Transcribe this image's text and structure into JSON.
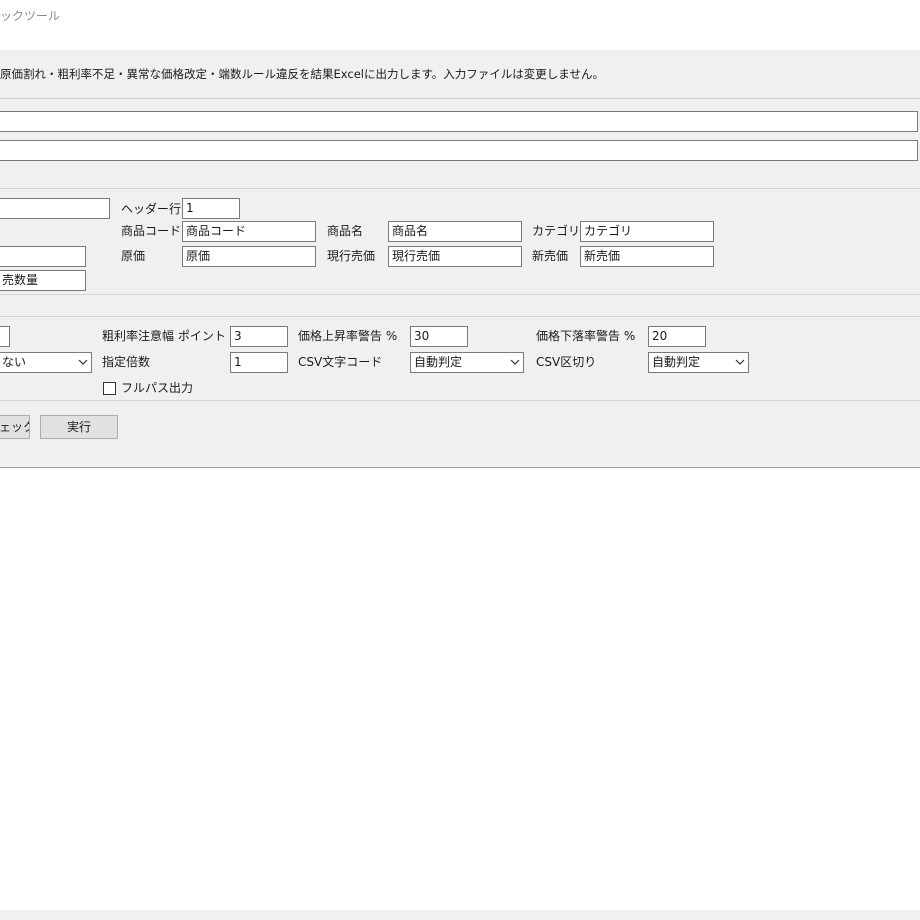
{
  "window": {
    "title": "ックツール"
  },
  "description": "原価割れ・粗利率不足・異常な価格改定・端数ルール違反を結果Excelに出力します。入力ファイルは変更しません。",
  "columns": {
    "header_row_label": "ヘッダー行",
    "header_row_value": "1",
    "product_code_label": "商品コード",
    "product_code_value": "商品コード",
    "product_name_label": "商品名",
    "product_name_value": "商品名",
    "category_label": "カテゴリ",
    "category_value": "カテゴリ",
    "cost_label": "原価",
    "cost_value": "原価",
    "current_price_label": "現行売価",
    "current_price_value": "現行売価",
    "new_price_label": "新売価",
    "new_price_value": "新売価",
    "quantity_value": "売数量"
  },
  "options": {
    "margin_warning_label": "粗利率注意幅 ポイント",
    "margin_warning_value": "3",
    "price_up_label": "価格上昇率警告 %",
    "price_up_value": "30",
    "price_down_label": "価格下落率警告 %",
    "price_down_value": "20",
    "rounding_value": "ない",
    "multiple_label": "指定倍数",
    "multiple_value": "1",
    "csv_encoding_label": "CSV文字コード",
    "csv_encoding_value": "自動判定",
    "csv_delimiter_label": "CSV区切り",
    "csv_delimiter_value": "自動判定",
    "fullpath_label": "フルパス出力",
    "fullpath_checked": false
  },
  "actions": {
    "check_label": "ェック",
    "run_label": "実行"
  },
  "icons": {
    "dropdown": "chevron-down-icon",
    "checkbox": "checkbox-icon"
  }
}
